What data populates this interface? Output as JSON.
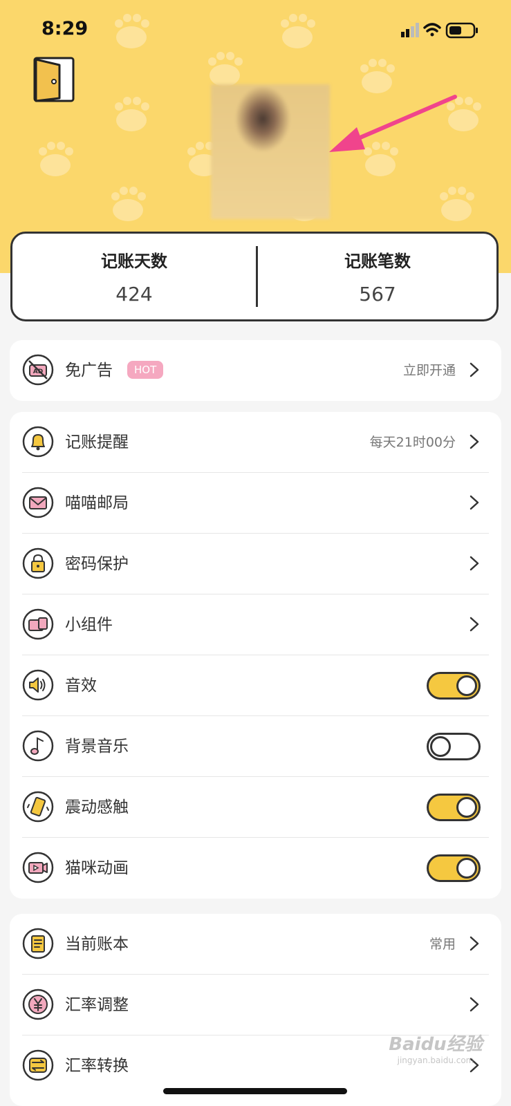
{
  "status_bar": {
    "time": "8:29"
  },
  "stats": {
    "days_label": "记账天数",
    "days_value": "424",
    "records_label": "记账笔数",
    "records_value": "567"
  },
  "ad_card": {
    "label": "免广告",
    "badge": "HOT",
    "value": "立即开通"
  },
  "settings": {
    "reminder": {
      "label": "记账提醒",
      "value": "每天21时00分"
    },
    "mail": {
      "label": "喵喵邮局"
    },
    "password": {
      "label": "密码保护"
    },
    "widget": {
      "label": "小组件"
    },
    "sound": {
      "label": "音效",
      "enabled": true
    },
    "music": {
      "label": "背景音乐",
      "enabled": false
    },
    "vibration": {
      "label": "震动感触",
      "enabled": true
    },
    "animation": {
      "label": "猫咪动画",
      "enabled": true
    }
  },
  "books": {
    "current": {
      "label": "当前账本",
      "value": "常用"
    },
    "rate_adjust": {
      "label": "汇率调整"
    },
    "rate_convert": {
      "label": "汇率转换"
    }
  },
  "watermark": {
    "line1": "Baidu经验",
    "line2": "jingyan.baidu.com"
  },
  "colors": {
    "header": "#fbd76b",
    "toggle_on": "#f5c840",
    "hot_badge": "#f5a8c0",
    "arrow": "#f0448c"
  },
  "icons": [
    "door-icon",
    "no-ad-icon",
    "bell-icon",
    "mail-icon",
    "lock-icon",
    "widget-icon",
    "speaker-icon",
    "music-note-icon",
    "vibrate-icon",
    "video-icon",
    "notebook-icon",
    "yen-icon",
    "exchange-icon",
    "chevron-right-icon"
  ]
}
